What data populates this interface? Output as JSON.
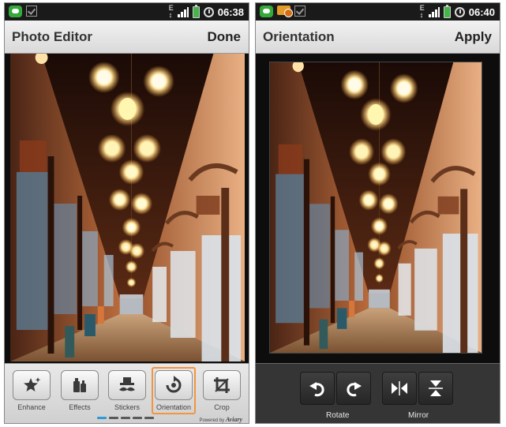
{
  "left_screen": {
    "status_time": "06:38",
    "title": "Photo Editor",
    "action": "Done",
    "tools": [
      {
        "label": "Enhance",
        "icon": "sparkle-star-icon"
      },
      {
        "label": "Effects",
        "icon": "effects-bottles-icon"
      },
      {
        "label": "Stickers",
        "icon": "mustache-hat-icon"
      },
      {
        "label": "Orientation",
        "icon": "rotate-icon",
        "selected": true
      },
      {
        "label": "Crop",
        "icon": "crop-icon"
      }
    ],
    "pager": {
      "count": 5,
      "active_index": 0
    },
    "powered_by_prefix": "Powered by",
    "powered_by_brand": "Aviary"
  },
  "right_screen": {
    "status_time": "06:40",
    "title": "Orientation",
    "action": "Apply",
    "groups": [
      {
        "label": "Rotate",
        "buttons": [
          "rotate-left-icon",
          "rotate-right-icon"
        ]
      },
      {
        "label": "Mirror",
        "buttons": [
          "flip-horizontal-icon",
          "flip-vertical-icon"
        ]
      }
    ]
  },
  "colors": {
    "accent_orange": "#f29540",
    "pager_active": "#2e9ad8",
    "battery_green": "#45b549",
    "chat_green": "#35a93a"
  }
}
